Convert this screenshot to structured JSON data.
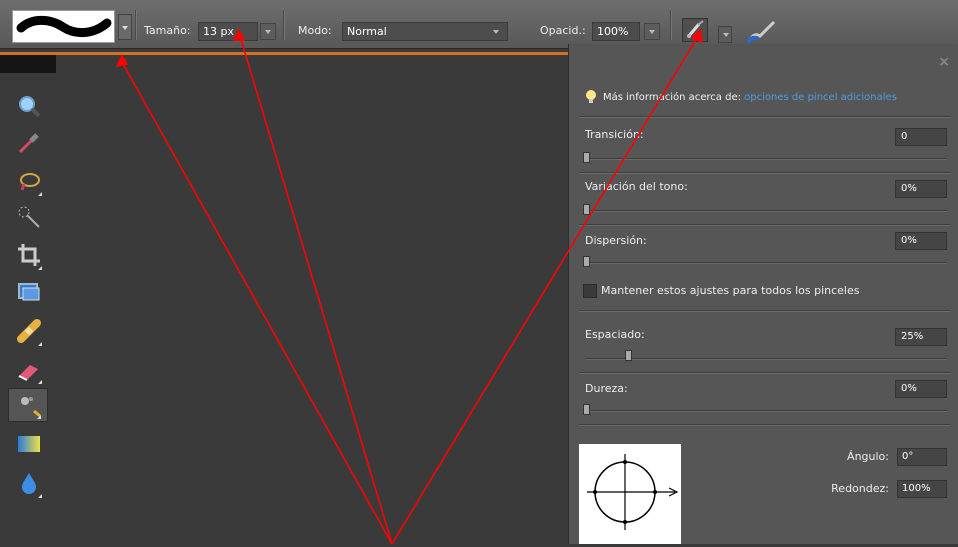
{
  "optionsbar": {
    "size_label": "Tamaño:",
    "size_value": "13 px",
    "mode_label": "Modo:",
    "mode_value": "Normal",
    "opacity_label": "Opacid.:",
    "opacity_value": "100%"
  },
  "panel": {
    "close_glyph": "×",
    "info_prefix": "Más información acerca de:",
    "info_link": "opciones de pincel adicionales",
    "fade_label": "Transición:",
    "fade_value": "0",
    "fade_level": 0,
    "hue_jitter_label": "Variación del tono:",
    "hue_jitter_value": "0%",
    "hue_jitter_level": 0,
    "scatter_label": "Dispersión:",
    "scatter_value": "0%",
    "scatter_level": 0,
    "keep_settings_label": "Mantener estos ajustes para todos los pinceles",
    "keep_settings_checked": false,
    "spacing_label": "Espaciado:",
    "spacing_value": "25%",
    "spacing_level": 0.25,
    "hardness_label": "Dureza:",
    "hardness_value": "0%",
    "hardness_level": 0,
    "angle_label": "Ángulo:",
    "angle_value": "0°",
    "roundness_label": "Redondez:",
    "roundness_value": "100%"
  },
  "tools": [
    {
      "name": "zoom-tool",
      "icon": "magnifier-icon"
    },
    {
      "name": "eyedropper-tool",
      "icon": "eyedropper-icon"
    },
    {
      "name": "lasso-tool",
      "icon": "lasso-icon"
    },
    {
      "name": "magic-wand-tool",
      "icon": "magic-wand-icon"
    },
    {
      "name": "crop-tool",
      "icon": "crop-icon"
    },
    {
      "name": "recompose-tool",
      "icon": "recompose-icon"
    },
    {
      "name": "healing-brush-tool",
      "icon": "bandage-icon"
    },
    {
      "name": "eraser-tool",
      "icon": "eraser-icon"
    },
    {
      "name": "brush-tool",
      "icon": "brush-icon"
    },
    {
      "name": "gradient-tool",
      "icon": "gradient-icon"
    },
    {
      "name": "blur-tool",
      "icon": "water-drop-icon"
    }
  ],
  "colors": {
    "accent_orange": "#d07020",
    "link_blue": "#4d9de0",
    "annotation_red": "#ff0000"
  }
}
